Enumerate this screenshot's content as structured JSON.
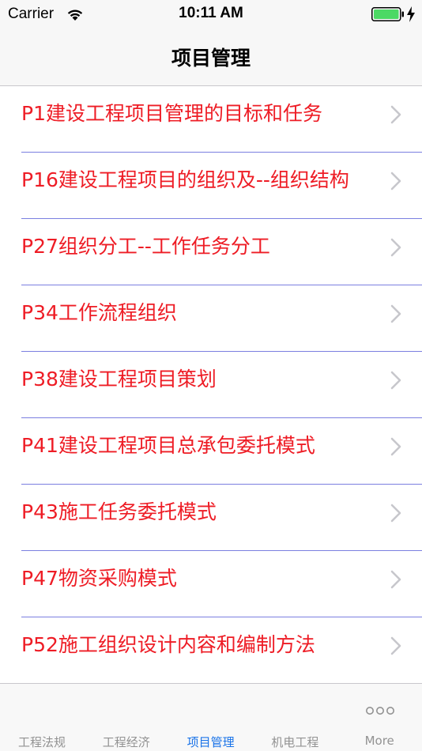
{
  "status_bar": {
    "carrier": "Carrier",
    "time": "10:11 AM",
    "icons": [
      "wifi-icon",
      "battery-icon",
      "charging-icon"
    ],
    "battery_color": "#4cd964"
  },
  "nav": {
    "title": "项目管理"
  },
  "colors": {
    "item_text": "#ee1c25",
    "separator": "#7b7fe0",
    "tab_active": "#1a73e8",
    "tab_inactive": "#929292"
  },
  "list": {
    "items": [
      {
        "label": "P1建设工程项目管理的目标和任务"
      },
      {
        "label": "P16建设工程项目的组织及--组织结构"
      },
      {
        "label": "P27组织分工--工作任务分工"
      },
      {
        "label": "P34工作流程组织"
      },
      {
        "label": "P38建设工程项目策划"
      },
      {
        "label": "P41建设工程项目总承包委托模式"
      },
      {
        "label": "P43施工任务委托模式"
      },
      {
        "label": "P47物资采购模式"
      },
      {
        "label": "P52施工组织设计内容和编制方法"
      }
    ],
    "chevron_icon": "chevron-right-icon"
  },
  "tab_bar": {
    "tabs": [
      {
        "label": "工程法规",
        "active": false
      },
      {
        "label": "工程经济",
        "active": false
      },
      {
        "label": "项目管理",
        "active": true
      },
      {
        "label": "机电工程",
        "active": false
      },
      {
        "label": "More",
        "active": false,
        "icon": "more-dots-icon"
      }
    ]
  }
}
